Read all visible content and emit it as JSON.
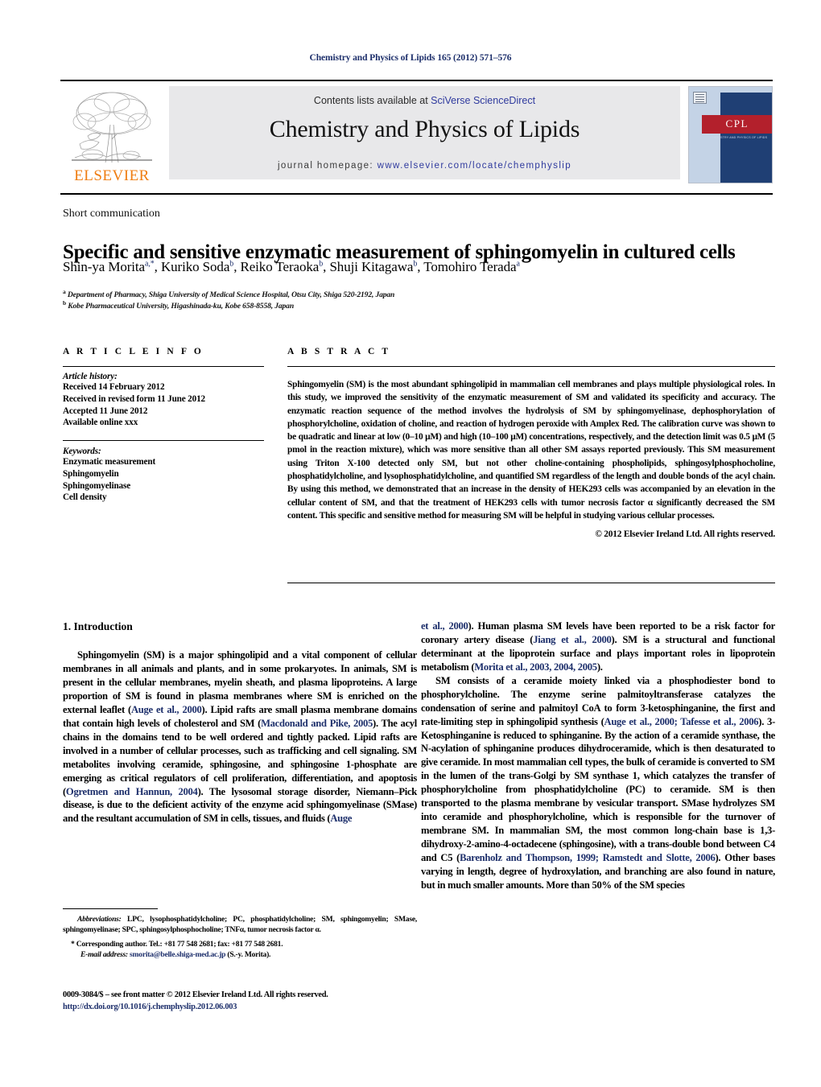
{
  "running_head": "Chemistry and Physics of Lipids 165 (2012) 571–576",
  "masthead": {
    "publisher_name": "ELSEVIER",
    "contents_prefix": "Contents lists available at ",
    "contents_link": "SciVerse ScienceDirect",
    "journal_title": "Chemistry and Physics of Lipids",
    "homepage_prefix": "journal homepage: ",
    "homepage_link": "www.elsevier.com/locate/chemphyslip",
    "cover": {
      "abbrev": "CPL",
      "subtitle": "CHEMISTRY AND PHYSICS OF LIPIDS"
    }
  },
  "article": {
    "section_type": "Short communication",
    "title": "Specific and sensitive enzymatic measurement of sphingomyelin in cultured cells",
    "authors_html": "Shin-ya Morita<sup>a,*</sup>, Kuriko Soda<sup>b</sup>, Reiko Teraoka<sup>b</sup>, Shuji Kitagawa<sup>b</sup>, Tomohiro Terada<sup>a</sup>",
    "affiliations": [
      "Department of Pharmacy, Shiga University of Medical Science Hospital, Otsu City, Shiga 520-2192, Japan",
      "Kobe Pharmaceutical University, Higashinada-ku, Kobe 658-8558, Japan"
    ],
    "affiliation_marks": [
      "a",
      "b"
    ]
  },
  "info": {
    "heading": "A R T I C L E   I N F O",
    "history_label": "Article history:",
    "history": [
      "Received 14 February 2012",
      "Received in revised form 11 June 2012",
      "Accepted 11 June 2012",
      "Available online xxx"
    ],
    "keywords_label": "Keywords:",
    "keywords": [
      "Enzymatic measurement",
      "Sphingomyelin",
      "Sphingomyelinase",
      "Cell density"
    ]
  },
  "abstract": {
    "heading": "A B S T R A C T",
    "text": "Sphingomyelin (SM) is the most abundant sphingolipid in mammalian cell membranes and plays multiple physiological roles. In this study, we improved the sensitivity of the enzymatic measurement of SM and validated its specificity and accuracy. The enzymatic reaction sequence of the method involves the hydrolysis of SM by sphingomyelinase, dephosphorylation of phosphorylcholine, oxidation of choline, and reaction of hydrogen peroxide with Amplex Red. The calibration curve was shown to be quadratic and linear at low (0–10 μM) and high (10–100 μM) concentrations, respectively, and the detection limit was 0.5 μM (5 pmol in the reaction mixture), which was more sensitive than all other SM assays reported previously. This SM measurement using Triton X-100 detected only SM, but not other choline-containing phospholipids, sphingosylphosphocholine, phosphatidylcholine, and lysophosphatidylcholine, and quantified SM regardless of the length and double bonds of the acyl chain. By using this method, we demonstrated that an increase in the density of HEK293 cells was accompanied by an elevation in the cellular content of SM, and that the treatment of HEK293 cells with tumor necrosis factor α significantly decreased the SM content. This specific and sensitive method for measuring SM will be helpful in studying various cellular processes.",
    "copyright": "© 2012 Elsevier Ireland Ltd. All rights reserved."
  },
  "body": {
    "section_number_title": "1.  Introduction",
    "left_paragraph_html": "Sphingomyelin (SM) is a major sphingolipid and a vital component of cellular membranes in all animals and plants, and in some prokaryotes. In animals, SM is present in the cellular membranes, myelin sheath, and plasma lipoproteins. A large proportion of SM is found in plasma membranes where SM is enriched on the external leaflet (<span class=\"ref\">Auge et al., 2000</span>). Lipid rafts are small plasma membrane domains that contain high levels of cholesterol and SM (<span class=\"ref\">Macdonald and Pike, 2005</span>). The acyl chains in the domains tend to be well ordered and tightly packed. Lipid rafts are involved in a number of cellular processes, such as trafficking and cell signaling. SM metabolites involving ceramide, sphingosine, and sphingosine 1-phosphate are emerging as critical regulators of cell proliferation, differentiation, and apoptosis (<span class=\"ref\">Ogretmen and Hannun, 2004</span>). The lysosomal storage disorder, Niemann–Pick disease, is due to the deficient activity of the enzyme acid sphingomyelinase (SMase) and the resultant accumulation of SM in cells, tissues, and fluids (<span class=\"ref\">Auge</span>",
    "right_paragraph1_html": "<span class=\"ref\">et al., 2000</span>). Human plasma SM levels have been reported to be a risk factor for coronary artery disease (<span class=\"ref\">Jiang et al., 2000</span>). SM is a structural and functional determinant at the lipoprotein surface and plays important roles in lipoprotein metabolism (<span class=\"ref\">Morita et al., 2003, 2004, 2005</span>).",
    "right_paragraph2_html": "SM consists of a ceramide moiety linked via a phosphodiester bond to phosphorylcholine. The enzyme serine palmitoyltransferase catalyzes the condensation of serine and palmitoyl CoA to form 3-ketosphinganine, the first and rate-limiting step in sphingolipid synthesis (<span class=\"ref\">Auge et al., 2000; Tafesse et al., 2006</span>). 3-Ketosphinganine is reduced to sphinganine. By the action of a ceramide synthase, the N-acylation of sphinganine produces dihydroceramide, which is then desaturated to give ceramide. In most mammalian cell types, the bulk of ceramide is converted to SM in the lumen of the trans-Golgi by SM synthase 1, which catalyzes the transfer of phosphorylcholine from phosphatidylcholine (PC) to ceramide. SM is then transported to the plasma membrane by vesicular transport. SMase hydrolyzes SM into ceramide and phosphorylcholine, which is responsible for the turnover of membrane SM. In mammalian SM, the most common long-chain base is 1,3-dihydroxy-2-amino-4-octadecene (sphingosine), with a trans-double bond between C4 and C5 (<span class=\"ref\">Barenholz and Thompson, 1999; Ramstedt and Slotte, 2006</span>). Other bases varying in length, degree of hydroxylation, and branching are also found in nature, but in much smaller amounts. More than 50% of the SM species"
  },
  "footnotes": {
    "abbreviations_label": "Abbreviations:",
    "abbreviations_text": " LPC, lysophosphatidylcholine; PC, phosphatidylcholine; SM, sphingomyelin; SMase, sphingomyelinase; SPC, sphingosylphosphocholine; TNFα, tumor necrosis factor α.",
    "corresponding": "* Corresponding author. Tel.: +81 77 548 2681; fax: +81 77 548 2681.",
    "email_label": "E-mail address:",
    "email": "smorita@belle.shiga-med.ac.jp",
    "email_suffix": " (S.-y. Morita)."
  },
  "imprint": {
    "line1": "0009-3084/$ – see front matter © 2012 Elsevier Ireland Ltd. All rights reserved.",
    "doi": "http://dx.doi.org/10.1016/j.chemphyslip.2012.06.003"
  },
  "colors": {
    "link": "#2f3a9e",
    "reference": "#1d2f6b",
    "elsevier_orange": "#ef7d12",
    "cover_blue": "#1f3f74",
    "cover_red": "#b3202c",
    "banner_gray": "#e8e8ea"
  }
}
